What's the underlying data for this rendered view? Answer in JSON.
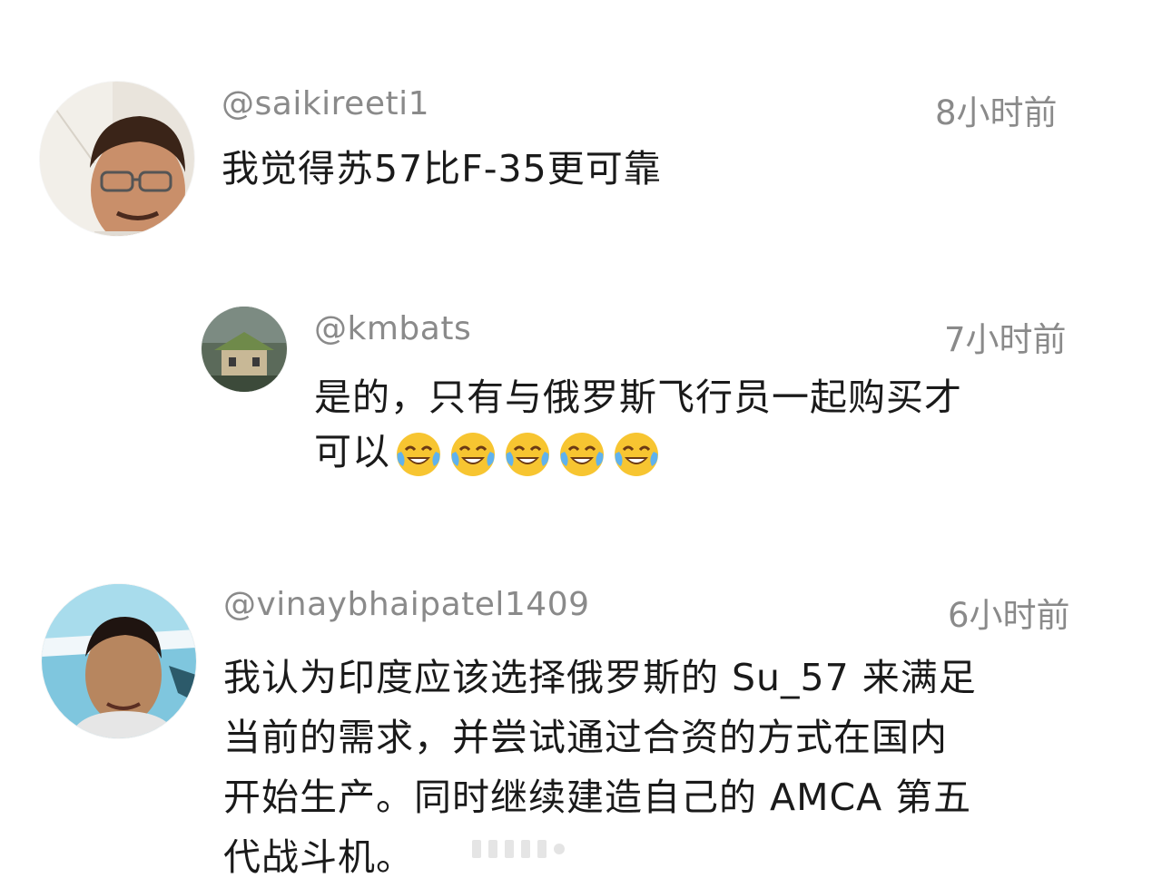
{
  "comments": [
    {
      "username": "@saikireeti1",
      "time": "8小时前",
      "text": "我觉得苏57比F-35更可靠",
      "avatar": "person-avatar",
      "reply": false
    },
    {
      "username": "@kmbats",
      "time": "7小时前",
      "text_line1": "是的，只有与俄罗斯飞行员一起购买才",
      "text_line2": "可以",
      "emoji": "face-with-tears-of-joy",
      "emoji_count": 5,
      "avatar": "building-avatar",
      "reply": true
    },
    {
      "username": "@vinaybhaipatel1409",
      "time": "6小时前",
      "lines": [
        "我认为印度应该选择俄罗斯的 Su_57 来满足",
        "当前的需求，并尝试通过合资的方式在国内",
        "开始生产。同时继续建造自己的 AMCA 第五",
        "代战斗机。"
      ],
      "avatar": "person-avatar",
      "reply": false
    }
  ],
  "colors": {
    "meta": "#8a8a8a",
    "text": "#1a1a1a",
    "background": "#ffffff"
  }
}
